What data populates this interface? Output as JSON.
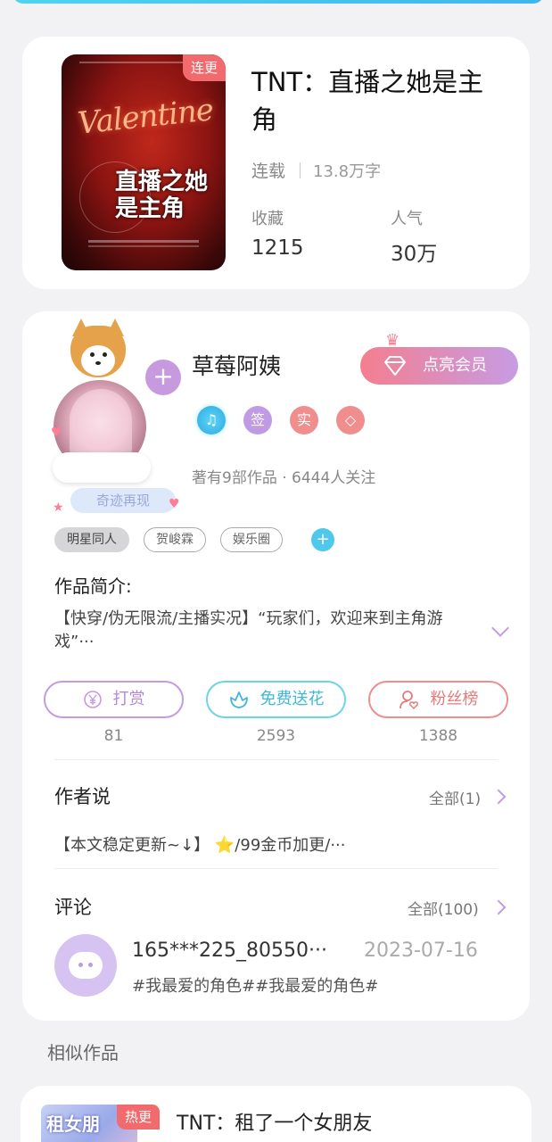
{
  "book": {
    "status_tag": "连更",
    "cover_script": "Valentine",
    "cover_title": "直播之她是主角",
    "title": "TNT：直播之她是主角",
    "status": "连载",
    "word_count": "13.8万字",
    "favorites_label": "收藏",
    "favorites_value": "1215",
    "popularity_label": "人气",
    "popularity_value": "30万"
  },
  "author": {
    "name": "草莓阿姨",
    "vip_button": "点亮会员",
    "badge_title": "奇迹再现",
    "stats": "著有9部作品 · 6444人关注",
    "icons": [
      {
        "name": "music-note-icon",
        "glyph": "♫"
      },
      {
        "name": "sign-badge-icon",
        "glyph": "签"
      },
      {
        "name": "real-name-badge-icon",
        "glyph": "实"
      },
      {
        "name": "diamond-badge-icon",
        "glyph": "◇"
      }
    ],
    "tags": [
      "明星同人",
      "贺峻霖",
      "娱乐圈"
    ],
    "intro_heading": "作品简介:",
    "intro_text": "【快穿/伪无限流/主播实况】“玩家们，欢迎来到主角游戏”···"
  },
  "actions": {
    "reward_label": "打赏",
    "reward_count": "81",
    "flower_label": "免费送花",
    "flower_count": "2593",
    "fans_label": "粉丝榜",
    "fans_count": "1388"
  },
  "author_says": {
    "heading": "作者说",
    "link": "全部(1)",
    "text": "【本文稳定更新~↓】 ⭐/99金币加更/···"
  },
  "comments": {
    "heading": "评论",
    "link": "全部(100)",
    "user": "165***225_80550···",
    "date": "2023-07-16",
    "text": "#我最爱的角色##我最爱的角色#"
  },
  "similar": {
    "heading": "相似作品",
    "cover_label": "租女朋",
    "tag": "热更",
    "title": "TNT：租了一个女朋友"
  },
  "colors": {
    "accent_purple": "#c79ae0",
    "accent_cyan": "#4fc8ec",
    "accent_red": "#f06a6e"
  }
}
